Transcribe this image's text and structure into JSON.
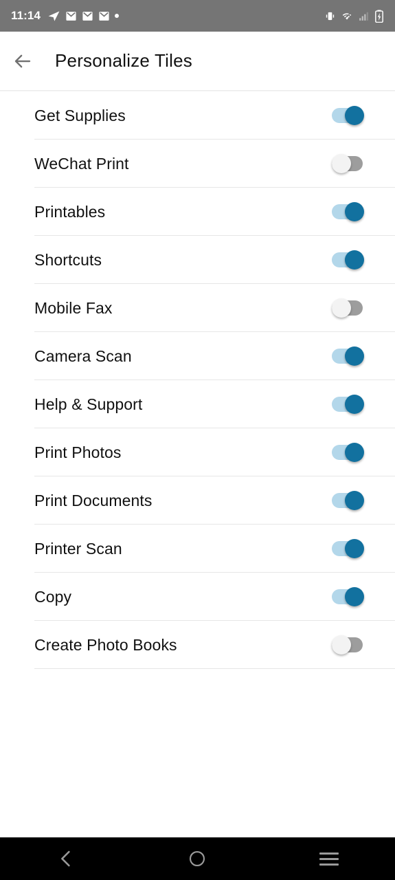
{
  "status_bar": {
    "time": "11:14",
    "background_color": "#757575",
    "left_icons": [
      "telegram-send-icon",
      "mail-icon",
      "mail-icon",
      "mail-icon",
      "dot-icon"
    ],
    "right_icons": [
      "vibrate-icon",
      "wifi-off-icon",
      "signal-bars-icon",
      "battery-charging-icon"
    ]
  },
  "app_bar": {
    "back_icon": "back-arrow-icon",
    "title": "Personalize Tiles"
  },
  "colors": {
    "switch_on_track": "#b3d7ea",
    "switch_on_thumb": "#12719f",
    "switch_off_track": "#9d9d9d",
    "switch_off_thumb": "#f3f3f3",
    "divider": "#e6e6e6",
    "text": "#111111"
  },
  "tiles": [
    {
      "label": "Get Supplies",
      "enabled": true,
      "state_text": "On"
    },
    {
      "label": "WeChat Print",
      "enabled": false,
      "state_text": "Off"
    },
    {
      "label": "Printables",
      "enabled": true,
      "state_text": "On"
    },
    {
      "label": "Shortcuts",
      "enabled": true,
      "state_text": "On"
    },
    {
      "label": "Mobile Fax",
      "enabled": false,
      "state_text": "Off"
    },
    {
      "label": "Camera Scan",
      "enabled": true,
      "state_text": "On"
    },
    {
      "label": "Help & Support",
      "enabled": true,
      "state_text": "On"
    },
    {
      "label": "Print Photos",
      "enabled": true,
      "state_text": "On"
    },
    {
      "label": "Print Documents",
      "enabled": true,
      "state_text": "On"
    },
    {
      "label": "Printer Scan",
      "enabled": true,
      "state_text": "On"
    },
    {
      "label": "Copy",
      "enabled": true,
      "state_text": "On"
    },
    {
      "label": "Create Photo Books",
      "enabled": false,
      "state_text": "Off"
    }
  ],
  "nav_bar": {
    "background_color": "#000000",
    "buttons": [
      {
        "name": "back",
        "icon": "chevron-left-icon"
      },
      {
        "name": "home",
        "icon": "circle-icon"
      },
      {
        "name": "recents",
        "icon": "hamburger-icon"
      }
    ]
  }
}
